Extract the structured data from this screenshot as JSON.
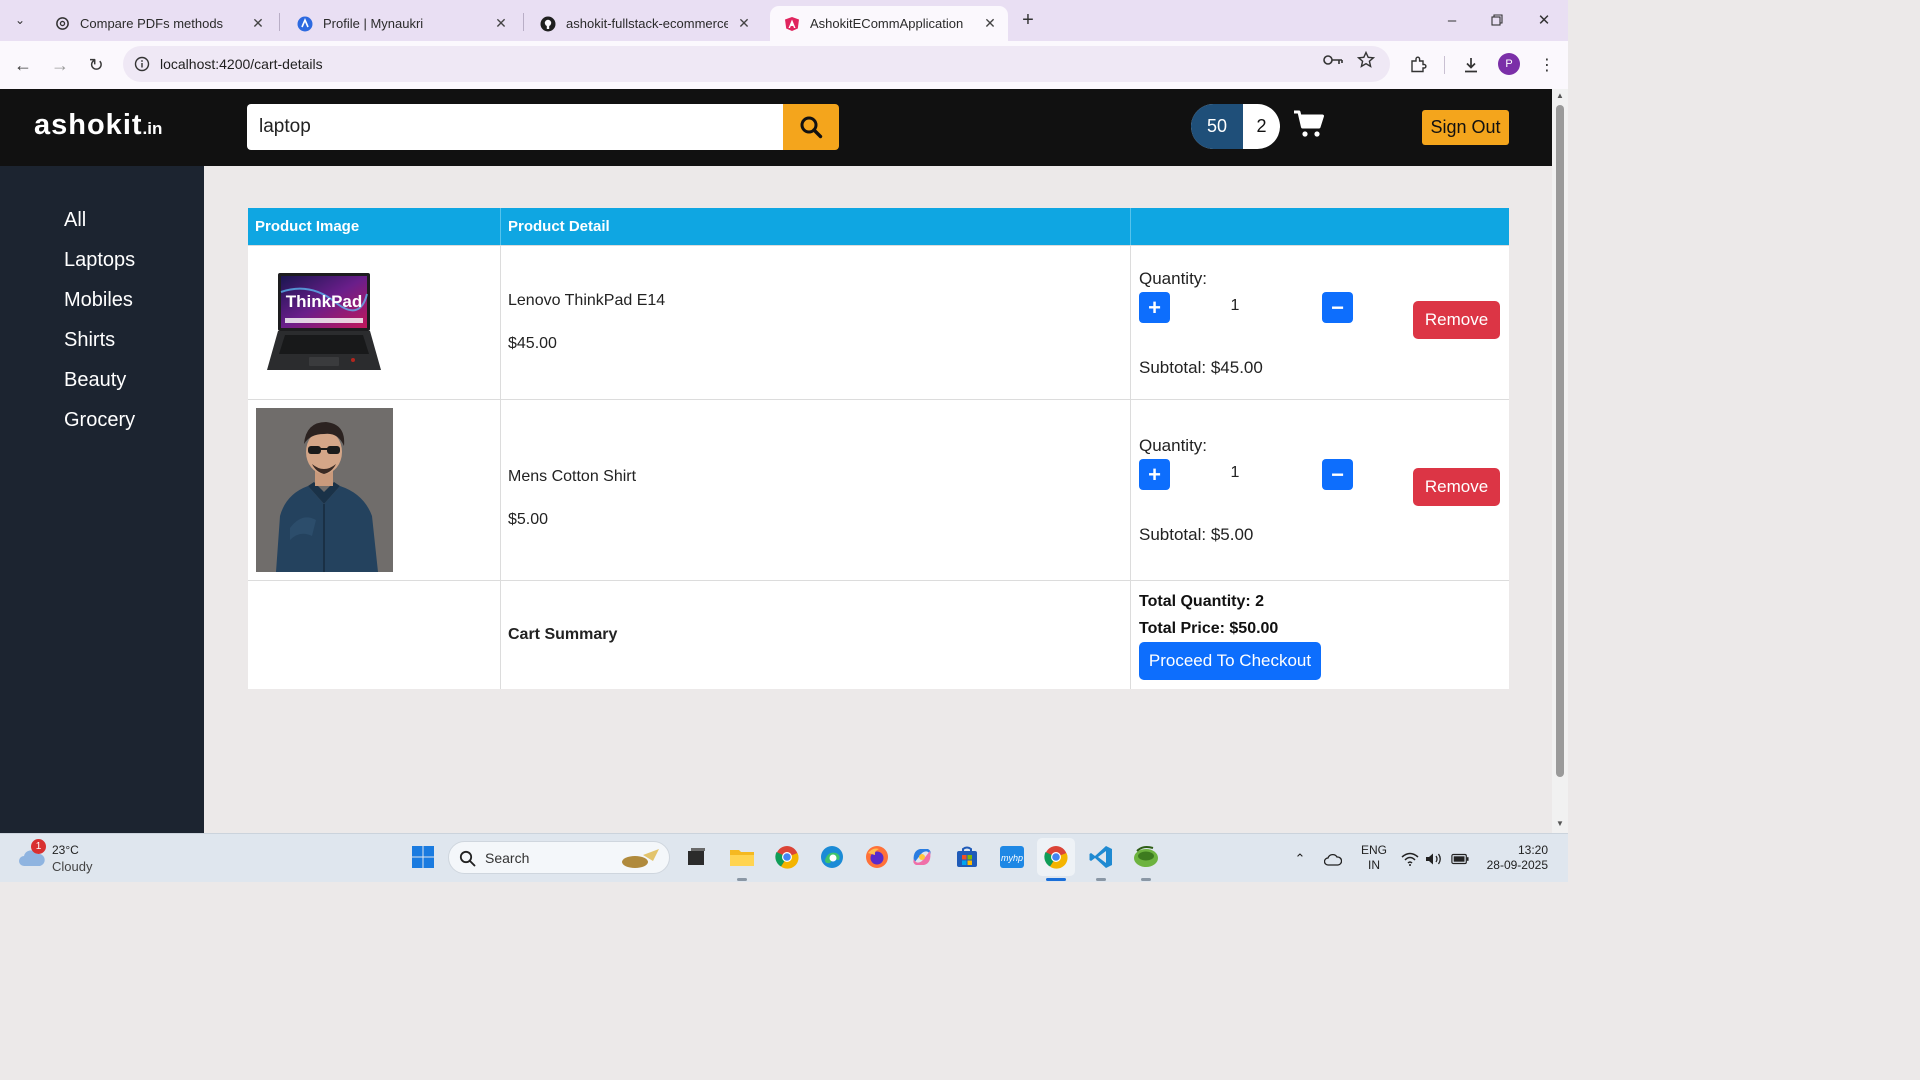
{
  "browser": {
    "tabs": [
      {
        "title": "Compare PDFs methods",
        "icon": "chatgpt-icon"
      },
      {
        "title": "Profile | Mynaukri",
        "icon": "naukri-icon"
      },
      {
        "title": "ashokit-fullstack-ecommerce/d",
        "icon": "github-icon"
      },
      {
        "title": "AshokitECommApplication",
        "icon": "angular-icon",
        "active": true
      }
    ],
    "url": "localhost:4200/cart-details"
  },
  "header": {
    "brand": "ashokit",
    "brand_suffix": ".in",
    "search_value": "laptop",
    "cart_total": "50",
    "cart_count": "2",
    "signout_label": "Sign Out"
  },
  "sidebar": {
    "items": [
      "All",
      "Laptops",
      "Mobiles",
      "Shirts",
      "Beauty",
      "Grocery"
    ]
  },
  "cart": {
    "headers": [
      "Product Image",
      "Product Detail",
      ""
    ],
    "items": [
      {
        "name": "Lenovo ThinkPad E14",
        "price": "$45.00",
        "quantity_label": "Quantity:",
        "quantity": "1",
        "subtotal": "Subtotal: $45.00",
        "remove_label": "Remove",
        "image": "laptop-image"
      },
      {
        "name": "Mens Cotton Shirt",
        "price": "$5.00",
        "quantity_label": "Quantity:",
        "quantity": "1",
        "subtotal": "Subtotal: $5.00",
        "remove_label": "Remove",
        "image": "shirt-image"
      }
    ],
    "summary": {
      "title": "Cart Summary",
      "total_quantity": "Total Quantity: 2",
      "total_price": "Total Price: $50.00",
      "checkout_label": "Proceed To Checkout"
    }
  },
  "taskbar": {
    "weather_temp": "23°C",
    "weather_desc": "Cloudy",
    "weather_badge": "1",
    "search_label": "Search",
    "lang_top": "ENG",
    "lang_bottom": "IN",
    "time": "13:20",
    "date": "28-09-2025"
  },
  "colors": {
    "header_bg": "#111111",
    "sidebar_bg": "#1c2430",
    "accent_orange": "#f4a51c",
    "table_header": "#0fa6e2",
    "primary_blue": "#0d6efd",
    "danger_red": "#dc3545"
  }
}
